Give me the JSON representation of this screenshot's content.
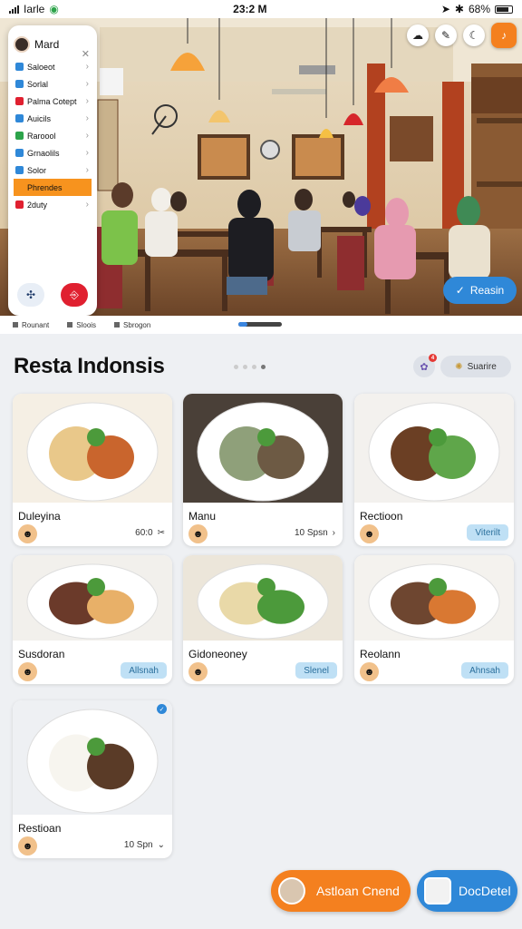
{
  "status": {
    "carrier": "Iarle",
    "time": "23:2 M",
    "battery": "68%"
  },
  "menu": {
    "user": "Mard",
    "items": [
      {
        "label": "Saloeot",
        "color": "#2f88d8"
      },
      {
        "label": "Sorlal",
        "color": "#2f88d8"
      },
      {
        "label": "Palma Cotept",
        "color": "#e02030"
      },
      {
        "label": "Auicils",
        "color": "#2f88d8"
      },
      {
        "label": "Raroool",
        "color": "#2ca34a"
      },
      {
        "label": "Grnaolils",
        "color": "#2f88d8"
      },
      {
        "label": "Solor",
        "color": "#2f88d8"
      },
      {
        "label": "Phrendes",
        "color": "#f7931e"
      },
      {
        "label": "2duty",
        "color": "#e02030"
      }
    ]
  },
  "reserve_label": "Reasin",
  "strip_tabs": [
    "Rounant",
    "Sloois",
    "Sbrogon"
  ],
  "page_title": "Resta Indonsis",
  "sort_label": "Suarire",
  "filter_count": "4",
  "cards": [
    {
      "name": "Duleyina",
      "meta": "60:0",
      "meta_icon": "✂"
    },
    {
      "name": "Manu",
      "meta": "10 Spsn",
      "meta_icon": "›"
    },
    {
      "name": "Rectioon",
      "pill": "Viterilt"
    },
    {
      "name": "Susdoran",
      "pill": "Allsnah"
    },
    {
      "name": "Gidoneoney",
      "pill": "Slenel"
    },
    {
      "name": "Reolann",
      "pill": "Ahnsah"
    },
    {
      "name": "Restioan",
      "meta": "10 Spn",
      "meta_icon": "⌄"
    }
  ],
  "bottom": {
    "primary": "Astloan Cnend",
    "secondary": "DocDetel"
  },
  "colors": {
    "accent": "#f4801f",
    "blue": "#2f88d8"
  }
}
